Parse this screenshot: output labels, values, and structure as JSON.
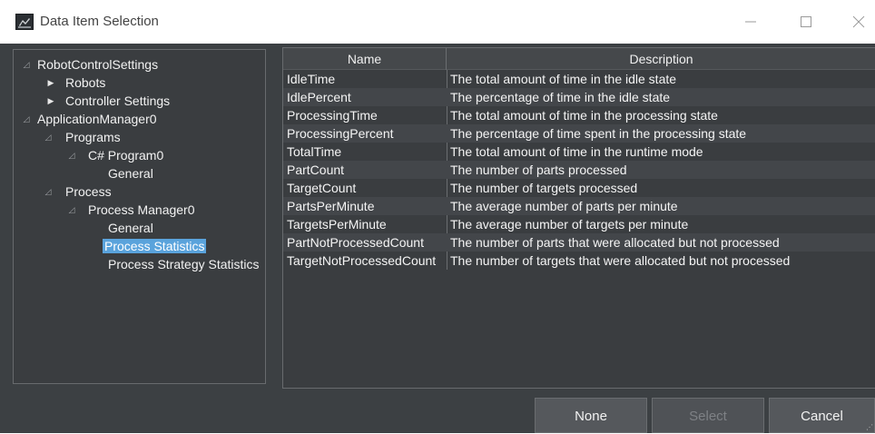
{
  "window": {
    "title": "Data Item Selection",
    "icon": "app-robot-icon"
  },
  "controls": {
    "minimize_icon": "minimize-icon",
    "maximize_icon": "maximize-icon",
    "close_icon": "close-icon"
  },
  "tree": {
    "items": [
      {
        "label": "RobotControlSettings",
        "state": "expanded"
      },
      {
        "label": "Robots",
        "state": "collapsed"
      },
      {
        "label": "Controller Settings",
        "state": "collapsed"
      },
      {
        "label": "ApplicationManager0",
        "state": "expanded"
      },
      {
        "label": "Programs",
        "state": "expanded"
      },
      {
        "label": "C# Program0",
        "state": "expanded"
      },
      {
        "label": "General",
        "state": "leaf"
      },
      {
        "label": "Process",
        "state": "expanded"
      },
      {
        "label": "Process Manager0",
        "state": "expanded"
      },
      {
        "label": "General",
        "state": "leaf"
      },
      {
        "label": "Process Statistics",
        "state": "leaf",
        "selected": true
      },
      {
        "label": "Process Strategy Statistics",
        "state": "leaf"
      }
    ]
  },
  "table": {
    "columns": [
      "Name",
      "Description"
    ],
    "rows": [
      {
        "name": "IdleTime",
        "description": "The total amount of time in the idle state"
      },
      {
        "name": "IdlePercent",
        "description": "The percentage of time in the idle state"
      },
      {
        "name": "ProcessingTime",
        "description": "The total amount of time in the processing state"
      },
      {
        "name": "ProcessingPercent",
        "description": "The percentage of time spent in the processing state"
      },
      {
        "name": "TotalTime",
        "description": "The total amount of time in the runtime mode"
      },
      {
        "name": "PartCount",
        "description": "The number of parts processed"
      },
      {
        "name": "TargetCount",
        "description": "The number of targets processed"
      },
      {
        "name": "PartsPerMinute",
        "description": "The average number of parts per minute"
      },
      {
        "name": "TargetsPerMinute",
        "description": "The average number of targets per minute"
      },
      {
        "name": "PartNotProcessedCount",
        "description": "The number of parts that were allocated but not processed"
      },
      {
        "name": "TargetNotProcessedCount",
        "description": "The number of targets that were allocated but not processed"
      }
    ]
  },
  "buttons": {
    "none": "None",
    "select": "Select",
    "select_state": "disabled",
    "cancel": "Cancel"
  },
  "colors": {
    "panel_background": "#3c4043",
    "selection": "#5aa3dc"
  }
}
